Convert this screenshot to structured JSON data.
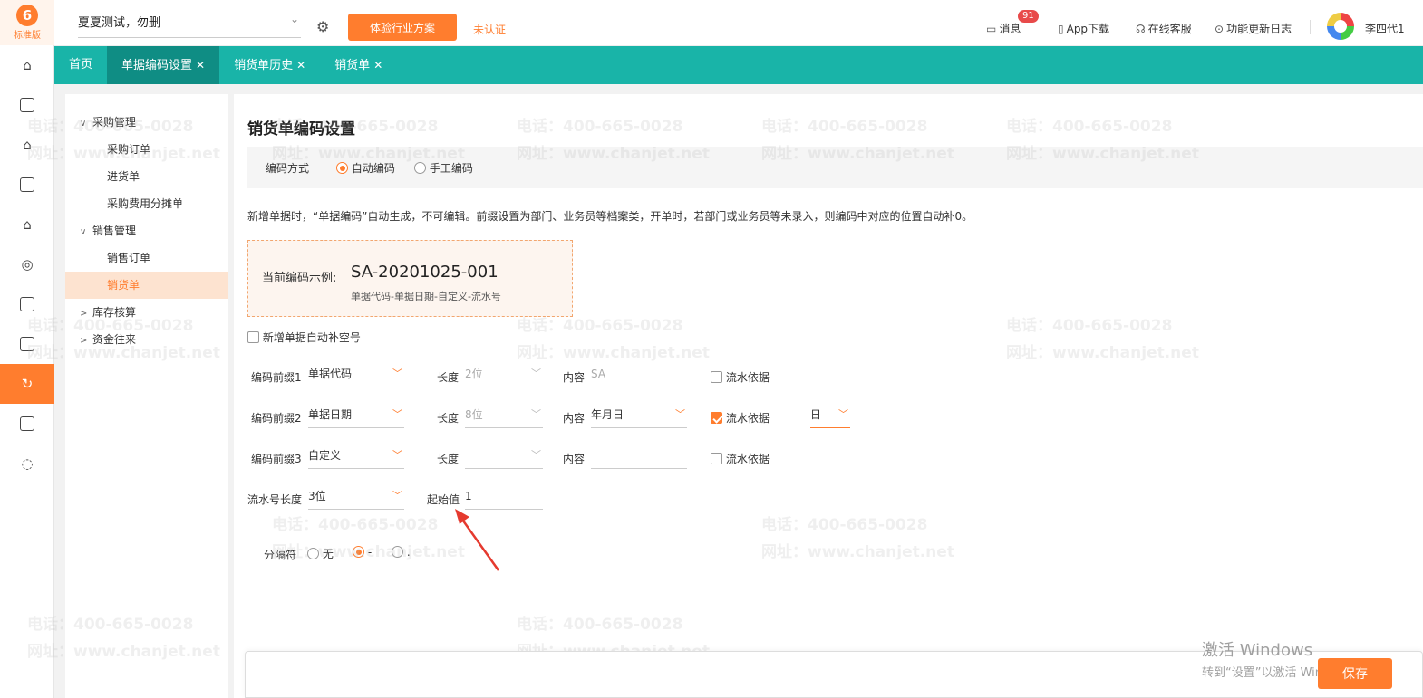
{
  "app": {
    "logo_text": "标准版",
    "logo_mark": "6"
  },
  "header": {
    "company": "夏夏测试，勿删",
    "plan_button": "体验行业方案",
    "unverified": "未认证",
    "messages_label": "消息",
    "messages_count": "91",
    "app_download": "App下载",
    "online_service": "在线客服",
    "changelog": "功能更新日志",
    "user_name": "李四代1"
  },
  "tabs": [
    {
      "label": "首页",
      "closable": false
    },
    {
      "label": "单据编码设置",
      "closable": true
    },
    {
      "label": "销货单历史",
      "closable": true
    },
    {
      "label": "销货单",
      "closable": true
    }
  ],
  "tree": {
    "purchase": "采购管理",
    "purchase_items": [
      "采购订单",
      "进货单",
      "采购费用分摊单"
    ],
    "sales": "销售管理",
    "sales_items": [
      "销售订单",
      "销货单"
    ],
    "inventory": "库存核算",
    "funds": "资金往来"
  },
  "main": {
    "title": "销货单编码设置",
    "mode_label": "编码方式",
    "mode_auto": "自动编码",
    "mode_manual": "手工编码",
    "note": "新增单据时，“单据编码”自动生成，不可编辑。前缀设置为部门、业务员等档案类，开单时，若部门或业务员等未录入，则编码中对应的位置自动补0。",
    "example_label": "当前编码示例:",
    "example_value": "SA-20201025-001",
    "example_format": "单据代码-单据日期-自定义-流水号",
    "autofill_label": "新增单据自动补空号",
    "length_label": "长度",
    "content_label": "内容",
    "serial_basis_label": "流水依据",
    "prefix_rows": [
      {
        "label": "编码前缀1",
        "prefix": "单据代码",
        "length": "2位",
        "content": "SA",
        "basis_checked": false,
        "basis_unit": ""
      },
      {
        "label": "编码前缀2",
        "prefix": "单据日期",
        "length": "8位",
        "content": "年月日",
        "basis_checked": true,
        "basis_unit": "日"
      },
      {
        "label": "编码前缀3",
        "prefix": "自定义",
        "length": "",
        "content": "",
        "basis_checked": false,
        "basis_unit": ""
      }
    ],
    "serial_length_label": "流水号长度",
    "serial_length": "3位",
    "start_value_label": "起始值",
    "start_value": "1",
    "separator_label": "分隔符",
    "separator_options": [
      "无",
      "-",
      "."
    ],
    "save_button": "保存"
  },
  "watermark": {
    "phone": "电话：400-665-0028",
    "site": "网址：www.chanjet.net"
  },
  "windows_activation": {
    "line1": "激活 Windows",
    "line2": "转到“设置”以激活 Windows。"
  },
  "colors": {
    "accent": "#ff7d2e",
    "tabbar": "#19b4a8",
    "tab_active": "#0f8d84"
  }
}
